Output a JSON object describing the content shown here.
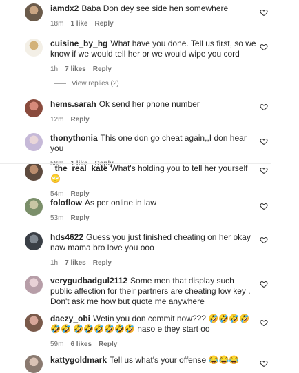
{
  "comments": [
    {
      "user": "iamdx2",
      "text": "Baba Don dey see side hen somewhere",
      "time": "18m",
      "likes": "1 like",
      "reply": "Reply"
    },
    {
      "user": "cuisine_by_hg",
      "text": "What have you done. Tell us first, so we know if we would tell her or we would wipe you cord",
      "time": "1h",
      "likes": "7 likes",
      "reply": "Reply"
    },
    {
      "user": "hems.sarah",
      "text": "Ok send her phone number",
      "time": "12m",
      "likes": "",
      "reply": "Reply"
    },
    {
      "user": "thonythonia",
      "text": "This one don go cheat again,,I don hear you",
      "time": "58m",
      "likes": "1 like",
      "reply": "Reply"
    },
    {
      "user": "_the_real_kate",
      "text": "What's holding you to tell her yourself 🙄",
      "time": "54m",
      "likes": "",
      "reply": "Reply"
    },
    {
      "user": "foloflow",
      "text": "As per online in law",
      "time": "53m",
      "likes": "",
      "reply": "Reply"
    },
    {
      "user": "hds4622",
      "text": "Guess you just finished cheating on her okay naw mama bro love you ooo",
      "time": "1h",
      "likes": "7 likes",
      "reply": "Reply"
    },
    {
      "user": "verygudbadgul2112",
      "text": "Some men that display such public affection for their partners are cheating low key . Don't ask me how but quote me anywhere",
      "time": "",
      "likes": "",
      "reply": ""
    },
    {
      "user": "daezy_obi",
      "text": "Wetin you don commit now??? 🤣🤣🤣🤣🤣🤣 🤣🤣🤣🤣🤣🤣 naso e they start oo",
      "time": "59m",
      "likes": "6 likes",
      "reply": "Reply"
    },
    {
      "user": "kattygoldmark",
      "text": "Tell us what's your offense 😂😂😂",
      "time": "",
      "likes": "",
      "reply": ""
    }
  ],
  "view_replies": "View replies (2)",
  "colors": {
    "text": "#262626",
    "meta": "#737373",
    "heart": "#262626"
  }
}
